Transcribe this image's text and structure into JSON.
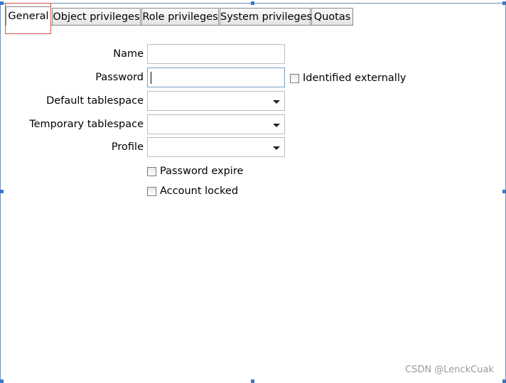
{
  "tabs": [
    {
      "label": "General",
      "active": true
    },
    {
      "label": "Object privileges",
      "active": false
    },
    {
      "label": "Role privileges",
      "active": false
    },
    {
      "label": "System privileges",
      "active": false
    },
    {
      "label": "Quotas",
      "active": false
    }
  ],
  "form": {
    "name_label": "Name",
    "name_value": "",
    "password_label": "Password",
    "password_value": "",
    "identified_externally_label": "Identified externally",
    "identified_externally_checked": false,
    "default_tablespace_label": "Default tablespace",
    "default_tablespace_value": "",
    "temporary_tablespace_label": "Temporary tablespace",
    "temporary_tablespace_value": "",
    "profile_label": "Profile",
    "profile_value": "",
    "password_expire_label": "Password expire",
    "password_expire_checked": false,
    "account_locked_label": "Account locked",
    "account_locked_checked": false
  },
  "watermark": "CSDN @LenckCuak",
  "colors": {
    "highlight_box": "#d9534f",
    "frame": "#6b8fb8",
    "handle": "#3c78c8"
  }
}
